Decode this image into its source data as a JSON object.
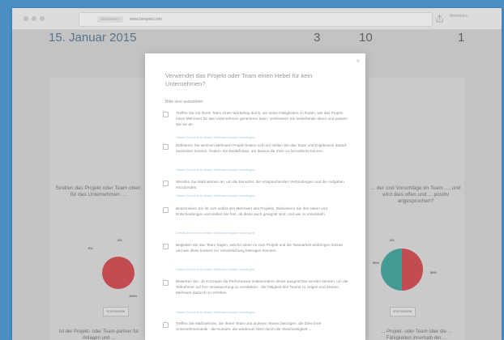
{
  "browser": {
    "url_pill": "Bearbeiten",
    "url": "www.beispiel.com",
    "right_label": "Abmelden"
  },
  "background": {
    "date": "15. Januar 2015",
    "numbers": [
      "3",
      "10",
      "1"
    ],
    "left_card": {
      "question": "Sind/en das Projekt oder Team oben für das Unternehmen ...",
      "pie_label_top": "0%",
      "pie_label_side": "0%",
      "pie_label_bottom": "100%",
      "button": "Kommentar",
      "footer": "Ist der Projekt- oder Team-partner für Anlagen und ..."
    },
    "right_card": {
      "question": "... der und Vorschläge im Team ..., und wird dies offen und ... positiv angesprochen?",
      "pie_label_top": "0%",
      "pie_label_side": "50%",
      "pie_label_bottom": "50%",
      "button": "Kommentar",
      "footer": "... Projekt- oder Team über die ... Fähigkeiten innerhalb der ..."
    },
    "colors": {
      "red": "#d13a41",
      "teal": "#2f9e96"
    }
  },
  "modal": {
    "close": "×",
    "title": "Verwendet das Projekt oder Team einen Hebel für kein Unternehmen?",
    "subtitle": "Bitte eine auswählen:",
    "options": [
      {
        "text": "Treffen Sie mit Ihrem Team einen Workshop durch, um seine Fähigkeiten zu finden, wie das Projekt einen Mehrwert für das Unternehmen generieren kann. Verbessern Sie bestehende Ideen und passen Sie sie an.",
        "link": "Dieses Element zu einem Maßnahmenplan hinzufügen"
      },
      {
        "text": "Definieren Sie welchen Mehrwert Projekt leisten soll und stellen Sie das Team und Ergebnisse darauf ausrichten können. Ändern Sie Bedürfnisse, um daraus die Ziele zu formulieren können.",
        "link": "Dieses Element zu einem Maßnahmenplan hinzufügen"
      },
      {
        "text": "Wenden Sie Maßnahmen an, um die Benutzer, die entsprechenden Verbindungen und die Aufgaben einzubinden.",
        "link": "Dieses Element zu einem Maßnahmenplan hinzufügen"
      },
      {
        "text": "Beschreiben Sie für sich selbst den Mehrwert des Projekts. Diskutieren Sie Ihre Ideen und Entscheidungen und stellen Sie fest, ob diese auch geeignet sind, und wie zu entwickeln.",
        "link": "Dieses Element zu einem Maßnahmenplan hinzufügen"
      },
      {
        "text": "Begleiten Sie das Team fragen, welche Ideen es zum Projekt und die Teamarbeit einbringen könnte und wie diese konkret zur Verwirklichung beitragen könnten.",
        "link": "Dieses Element zu einem Maßnahmenplan hinzufügen"
      },
      {
        "text": "Bewerten Sie, ob Konzepte die Performance insbesondere derart ausgerichtet werden können, um die Teilnehmer auf ihre Verantwortung zu verstärken - die Tätigkeit des Teams zu zeigen und dessen Mehrwert dadurch zu erhöhen.",
        "link": "Dieses Element zu einem Maßnahmenplan hinzufügen"
      },
      {
        "text": "Treffen Sie Maßnahmen, die Ihrem Team und anderen Teams beitragen, die Ziele ihrer Unternehmensteile - die Kunden, die wiederum Wert durch die Gleichzeitigkeit ...",
        "link": "Dieses Element zu einem Maßnahmenplan hinzufügen"
      }
    ]
  }
}
